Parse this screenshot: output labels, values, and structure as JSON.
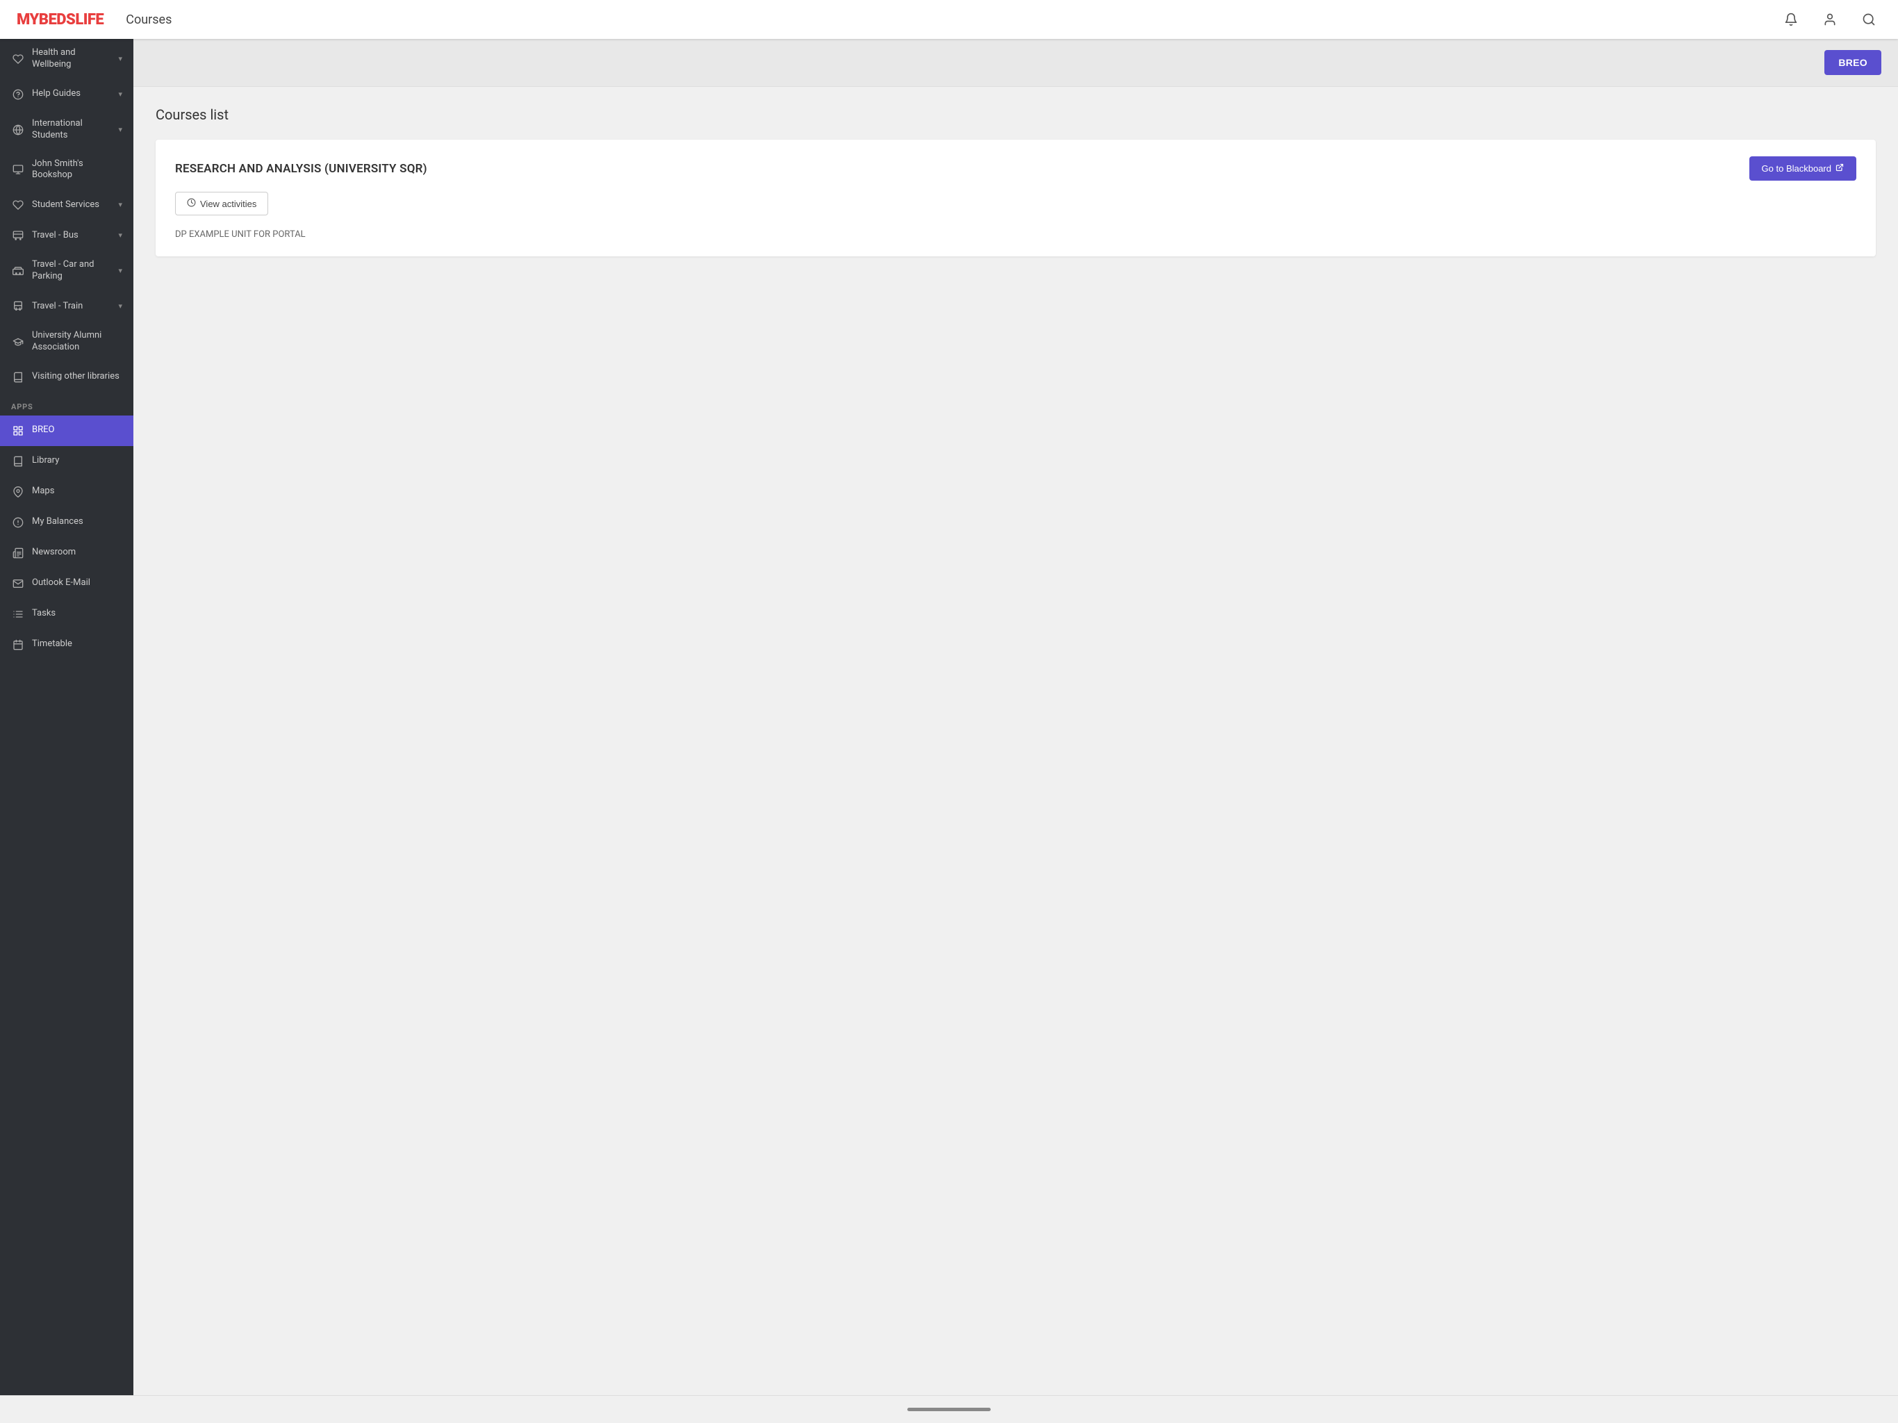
{
  "header": {
    "logo_my": "MY",
    "logo_beds": "BEDS",
    "logo_life": "LIFE",
    "page_title": "Courses",
    "icons": {
      "bell": "🔔",
      "user": "👤",
      "search": "🔍"
    }
  },
  "top_bar": {
    "breo_button_label": "BREO"
  },
  "sidebar": {
    "nav_items": [
      {
        "id": "health-wellbeing",
        "label": "Health and Wellbeing",
        "icon": "❤",
        "has_chevron": true
      },
      {
        "id": "help-guides",
        "label": "Help Guides",
        "icon": "❓",
        "has_chevron": true
      },
      {
        "id": "international-students",
        "label": "International Students",
        "icon": "🌐",
        "has_chevron": true
      },
      {
        "id": "john-smith-bookshop",
        "label": "John Smith's Bookshop",
        "icon": "💷",
        "has_chevron": false
      },
      {
        "id": "student-services",
        "label": "Student Services",
        "icon": "❤",
        "has_chevron": true
      },
      {
        "id": "travel-bus",
        "label": "Travel - Bus",
        "icon": "🚌",
        "has_chevron": true
      },
      {
        "id": "travel-car-parking",
        "label": "Travel - Car and Parking",
        "icon": "🚗",
        "has_chevron": true
      },
      {
        "id": "travel-train",
        "label": "Travel - Train",
        "icon": "🚆",
        "has_chevron": true
      },
      {
        "id": "university-alumni",
        "label": "University Alumni Association",
        "icon": "🎓",
        "has_chevron": false
      },
      {
        "id": "visiting-libraries",
        "label": "Visiting other libraries",
        "icon": "📚",
        "has_chevron": false
      }
    ],
    "apps_section_label": "APPS",
    "app_items": [
      {
        "id": "breo",
        "label": "BREO",
        "icon": "🏛",
        "active": true
      },
      {
        "id": "library",
        "label": "Library",
        "icon": "📖",
        "active": false
      },
      {
        "id": "maps",
        "label": "Maps",
        "icon": "📍",
        "active": false
      },
      {
        "id": "my-balances",
        "label": "My Balances",
        "icon": "💰",
        "active": false
      },
      {
        "id": "newsroom",
        "label": "Newsroom",
        "icon": "📰",
        "active": false
      },
      {
        "id": "outlook-email",
        "label": "Outlook E-Mail",
        "icon": "✉",
        "active": false
      },
      {
        "id": "tasks",
        "label": "Tasks",
        "icon": "📋",
        "active": false
      },
      {
        "id": "timetable",
        "label": "Timetable",
        "icon": "📅",
        "active": false
      }
    ]
  },
  "main": {
    "courses_list_title": "Courses list",
    "course_card": {
      "title": "RESEARCH AND ANALYSIS (UNIVERSITY SQR)",
      "go_blackboard_label": "Go to Blackboard",
      "view_activities_label": "View activities",
      "subtitle": "DP EXAMPLE UNIT FOR PORTAL"
    }
  }
}
